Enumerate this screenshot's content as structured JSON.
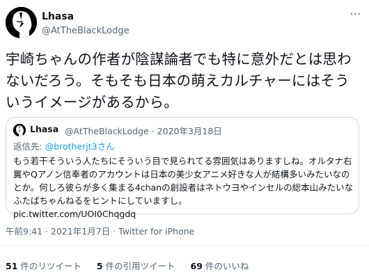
{
  "author": {
    "name": "Lhasa",
    "handle": "@AtTheBlackLodge"
  },
  "tweet": {
    "text": "宇崎ちゃんの作者が陰謀論者でも特に意外だとは思わないだろう。そもそも日本の萌えカルチャーにはそういうイメージがあるから。"
  },
  "quote": {
    "name": "Lhasa",
    "handle_date": "@AtTheBlackLodge · 2020年3月18日",
    "reply_prefix": "返信先: ",
    "reply_mention": "@brotherjt3さん",
    "text": "もう若干そういう人たちにそういう目で見られてる雰囲気はありますしね。オルタナ右翼やQアノン信奉者のアカウントは日本の美少女アニメ好きな人が結構多いみたいなのとか。何しろ彼らが多く集まる4chanの創設者はネトウヨやインセルの総本山みたいなふたばちゃんねるをヒントにしていますし。",
    "link": "pic.twitter.com/UOI0Chqgdq"
  },
  "meta": {
    "time_date": "午前9:41 · 2021年1月7日 · ",
    "source": "Twitter for iPhone"
  },
  "stats": {
    "retweets_count": "51",
    "retweets_label": " 件のリツイート",
    "quotes_count": "5",
    "quotes_label": " 件の引用ツイート",
    "likes_count": "69",
    "likes_label": " 件のいいね"
  },
  "icons": {
    "avatar": "bowie-silhouette-avatar",
    "more": "more-icon"
  },
  "colors": {
    "text": "#0f1419",
    "secondary": "#536471",
    "link": "#1d9bf0",
    "border": "#cfd9de"
  }
}
